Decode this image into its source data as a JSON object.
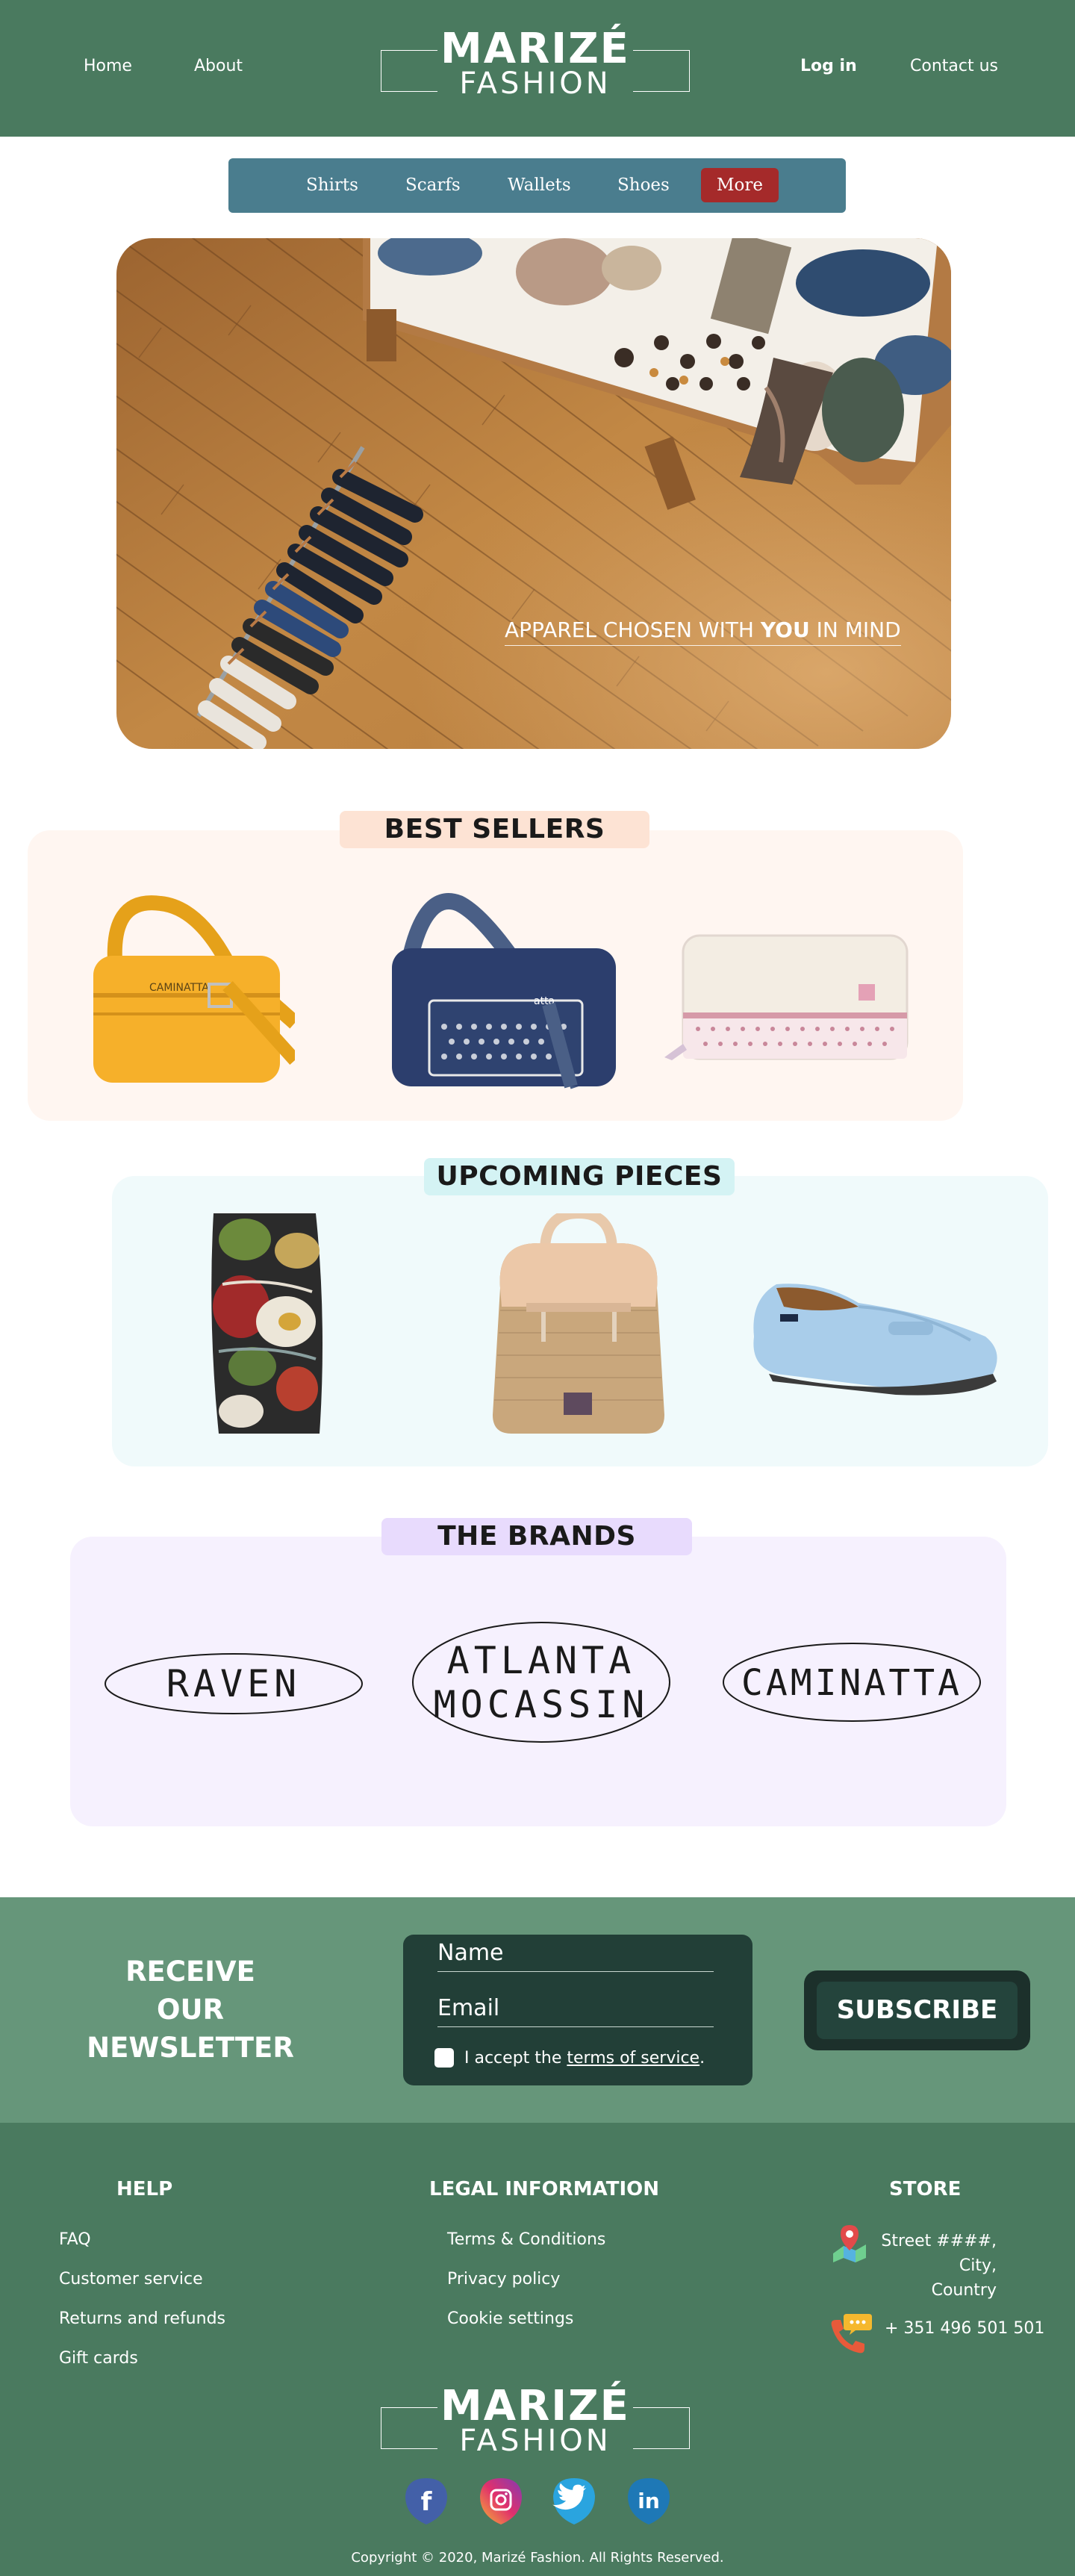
{
  "header": {
    "nav_left": [
      "Home",
      "About"
    ],
    "logo_main": "MARIZÉ",
    "logo_sub": "FASHION",
    "login": "Log in",
    "contact": "Contact us"
  },
  "categories": [
    "Shirts",
    "Scarfs",
    "Wallets",
    "Shoes"
  ],
  "categories_more": "More",
  "hero": {
    "tagline_pre": "APPAREL CHOSEN WITH ",
    "tagline_bold": "YOU",
    "tagline_post": " IN MIND"
  },
  "sections": {
    "best_sellers": {
      "title": "BEST SELLERS",
      "products": [
        "yellow-crossbody-bag",
        "navy-shoulder-bag",
        "pink-wallet"
      ],
      "bag_label": "CAMINATTA",
      "navy_label": "atta"
    },
    "upcoming": {
      "title": "UPCOMING PIECES",
      "products": [
        "floral-scarf",
        "woven-backpack",
        "light-blue-loafer"
      ]
    },
    "brands": {
      "title": "THE BRANDS",
      "items": [
        {
          "name": "RAVEN"
        },
        {
          "name": "ATLANTA",
          "name2": "MOCASSIN"
        },
        {
          "name": "CAMINATTA"
        }
      ]
    }
  },
  "newsletter": {
    "title": [
      "RECEIVE",
      "OUR",
      "NEWSLETTER"
    ],
    "name_placeholder": "Name",
    "email_placeholder": "Email",
    "accept_text": "I accept the ",
    "terms_link": "terms of service",
    "accept_end": ".",
    "subscribe": "SUBSCRIBE"
  },
  "footer": {
    "help_title": "HELP",
    "help_links": [
      "FAQ",
      "Customer service",
      "Returns and refunds",
      "Gift cards"
    ],
    "legal_title": "LEGAL INFORMATION",
    "legal_links": [
      "Terms & Conditions",
      "Privacy policy",
      "Cookie settings"
    ],
    "store_title": "STORE",
    "address": [
      "Street ####,",
      "City,",
      "Country"
    ],
    "phone": "+ 351 496 501 501",
    "logo_main": "MARIZÉ",
    "logo_sub": "FASHION",
    "social": [
      "facebook-icon",
      "instagram-icon",
      "twitter-icon",
      "linkedin-icon"
    ],
    "copyright": "Copyright © 2020, Marizé Fashion. All Rights Reserved."
  },
  "colors": {
    "header_green": "#4a7a5f",
    "category_bar": "#4a7d8e",
    "more_red": "#a52a2a",
    "best_sellers_bg": "#fff6f1",
    "best_sellers_title_bg": "#fde3d4",
    "upcoming_bg": "#f0fafb",
    "upcoming_title_bg": "#d4f3f4",
    "brands_bg": "#f6f1fe",
    "brands_title_bg": "#e8dbfd",
    "newsletter_bg": "#66967a",
    "form_bg": "#223f37"
  }
}
